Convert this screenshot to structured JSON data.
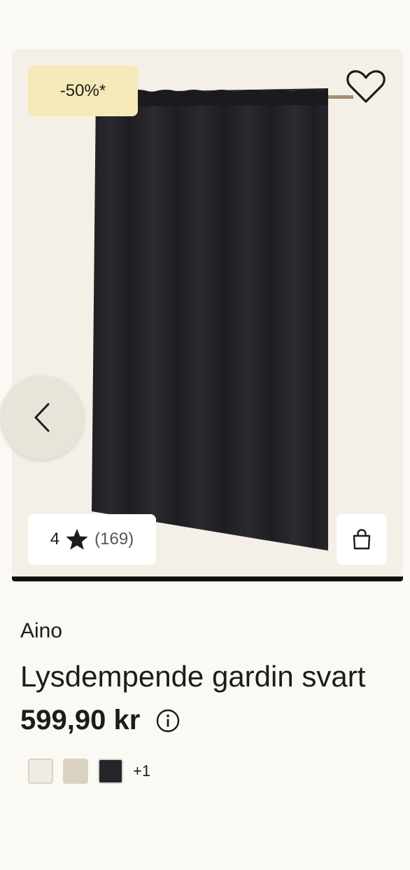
{
  "product": {
    "discount_badge": "-50%*",
    "brand": "Aino",
    "title": "Lysdempende gardin svart",
    "price": "599,90 kr",
    "rating_score": "4",
    "rating_count": "(169)",
    "more_colors": "+1",
    "swatches": [
      {
        "name": "off-white",
        "color": "#eeece3"
      },
      {
        "name": "beige",
        "color": "#dbd1c0"
      },
      {
        "name": "black",
        "color": "#25252b"
      }
    ]
  },
  "icons": {
    "wishlist": "heart-outline-icon",
    "prev": "chevron-left-icon",
    "rating_star": "star-icon",
    "cart": "shopping-bag-icon",
    "info": "info-circle-icon"
  },
  "colors": {
    "background": "#fbf9f3",
    "image_background": "#f4efe7",
    "badge": "#f5e9b7",
    "curtain": "#222226"
  }
}
